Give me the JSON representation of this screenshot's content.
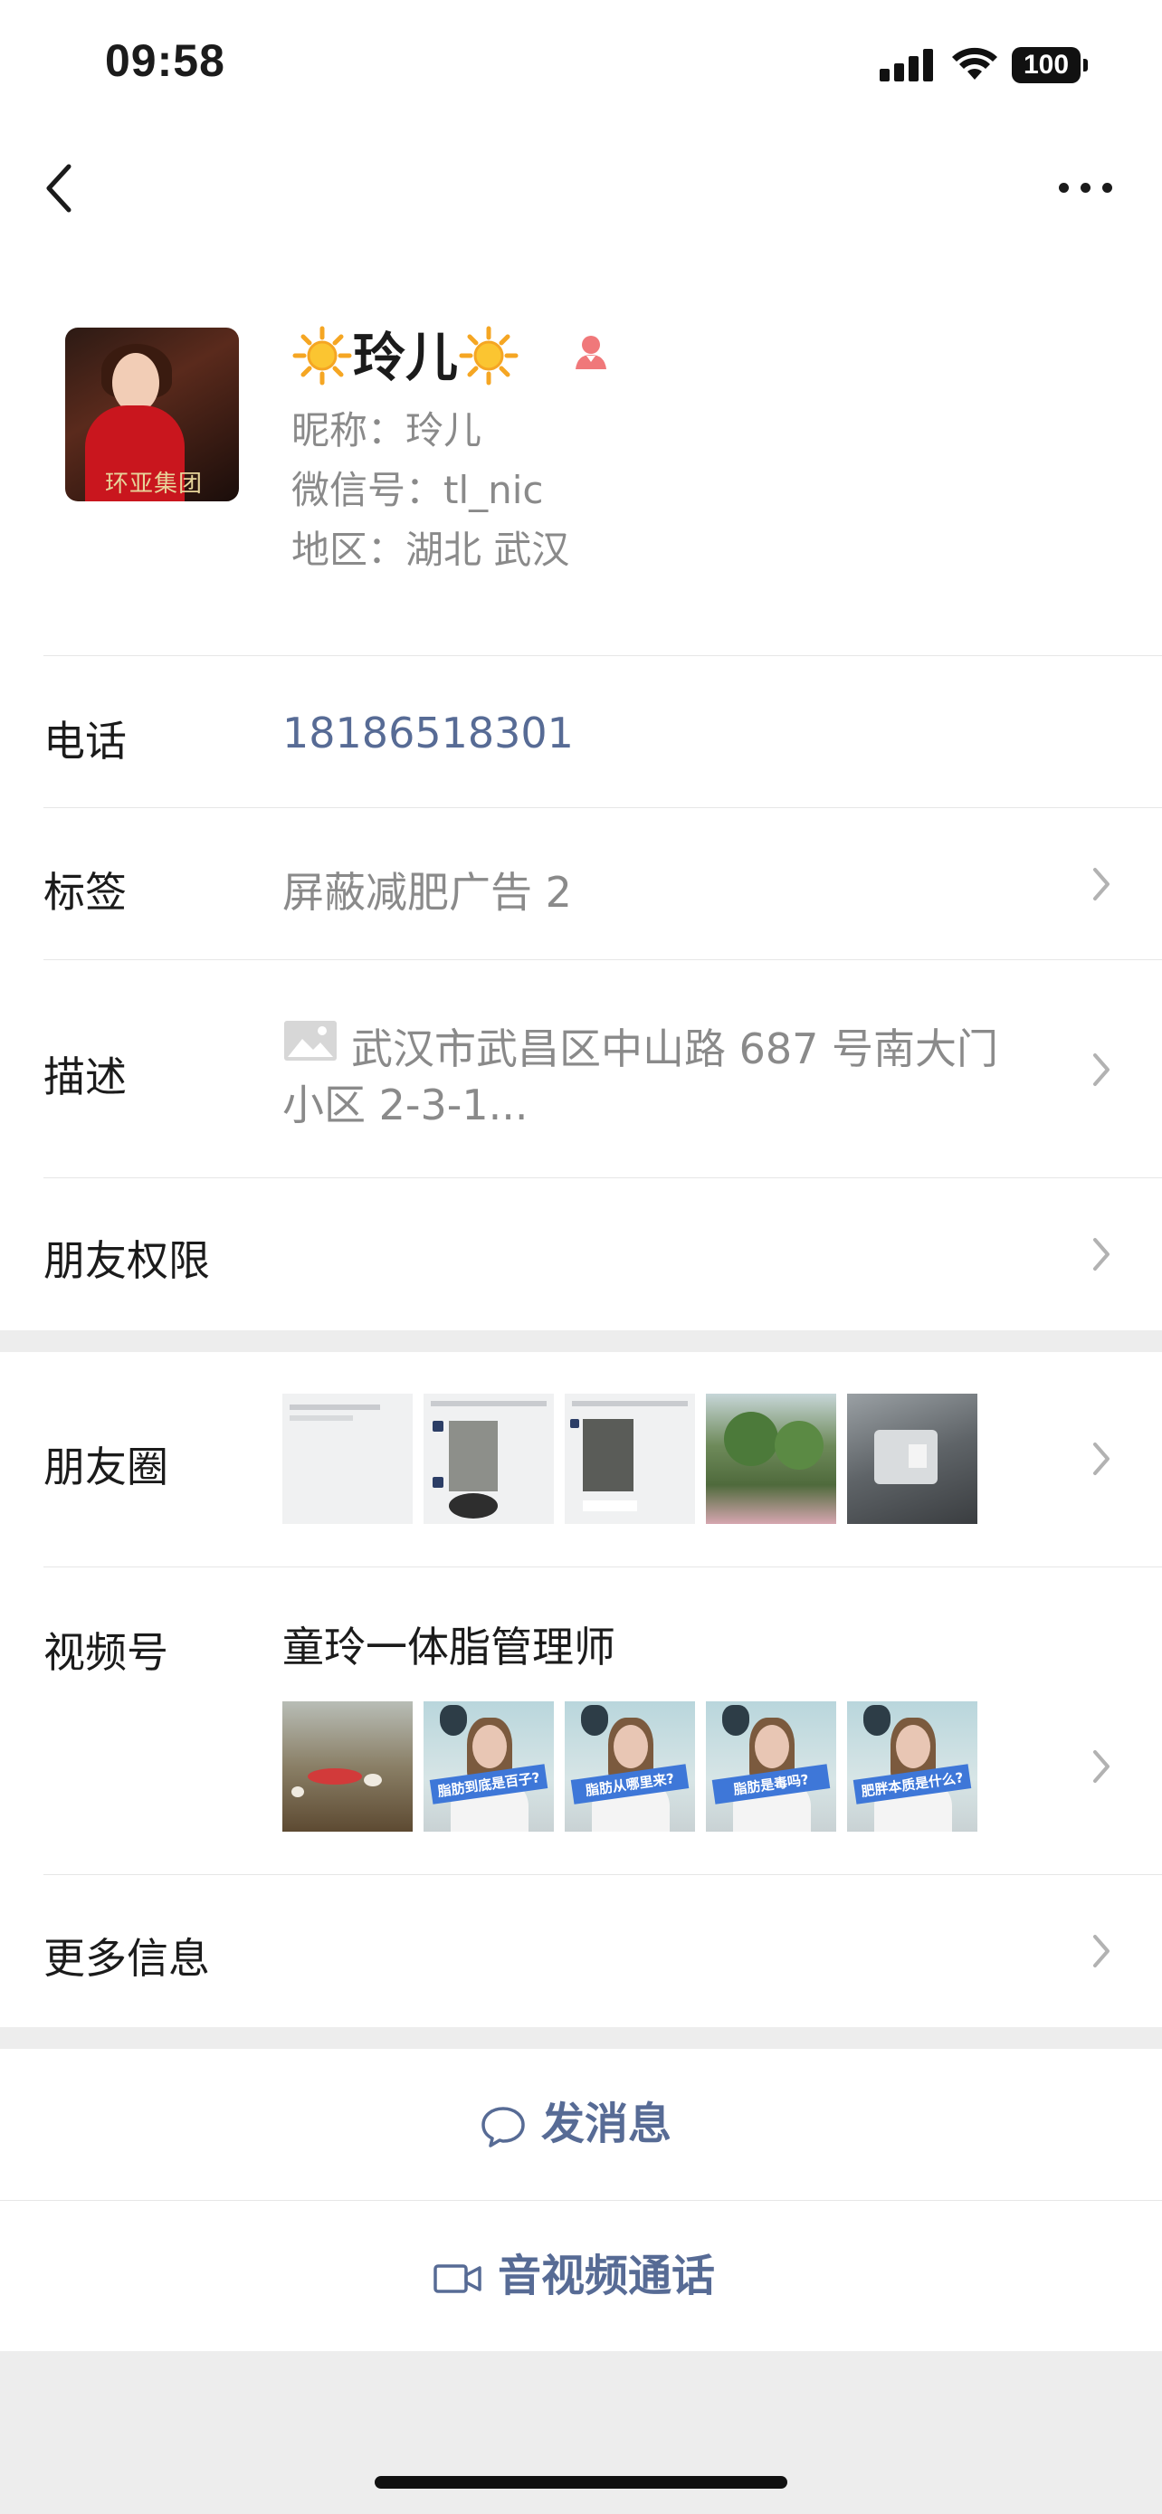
{
  "status_bar": {
    "time": "09:58",
    "battery": "100"
  },
  "profile": {
    "display_name": "玲儿",
    "nickname": "昵称：玲儿",
    "wechat_id": "微信号：tl_nic",
    "region": "地区：湖北 武汉",
    "avatar_text": "环亚集团"
  },
  "rows": {
    "phone": {
      "label": "电话",
      "value": "18186518301"
    },
    "tags": {
      "label": "标签",
      "value": "屏蔽减肥广告 2"
    },
    "description": {
      "label": "描述",
      "line1": "武汉市武昌区中山路 687 号南大门",
      "line2": "小区 2-3-1..."
    },
    "friend_permissions": {
      "label": "朋友权限"
    },
    "moments": {
      "label": "朋友圈"
    },
    "channels": {
      "label": "视频号",
      "name": "童玲一体脂管理师",
      "captions": [
        "脂肪到底是百子?",
        "脂肪从哪里来?",
        "脂肪是毒吗?",
        "肥胖本质是什么?"
      ]
    },
    "more_info": {
      "label": "更多信息"
    }
  },
  "actions": {
    "message": "发消息",
    "call": "音视频通话"
  },
  "colors": {
    "link_blue": "#576b95",
    "secondary_text": "#8a8a8a",
    "gap_gray": "#ededed"
  }
}
